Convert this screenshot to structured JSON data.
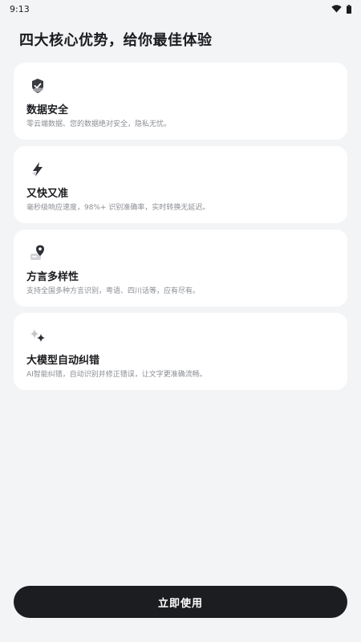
{
  "status_bar": {
    "time": "9:13"
  },
  "page_title": "四大核心优势，给你最佳体验",
  "features": [
    {
      "icon": "shield-check-icon",
      "title": "数据安全",
      "desc": "零云端数据、您的数据绝对安全，隐私无忧。"
    },
    {
      "icon": "lightning-icon",
      "title": "又快又准",
      "desc": "毫秒级响应速度，98%+ 识别准确率，实时转换无延迟。"
    },
    {
      "icon": "location-pin-icon",
      "title": "方言多样性",
      "desc": "支持全国多种方言识别，粤语、四川话等，应有尽有。"
    },
    {
      "icon": "sparkle-icon",
      "title": "大模型自动纠错",
      "desc": "AI智能纠错，自动识别并修正错误，让文字更准确流畅。"
    }
  ],
  "start_button_label": "立即使用"
}
